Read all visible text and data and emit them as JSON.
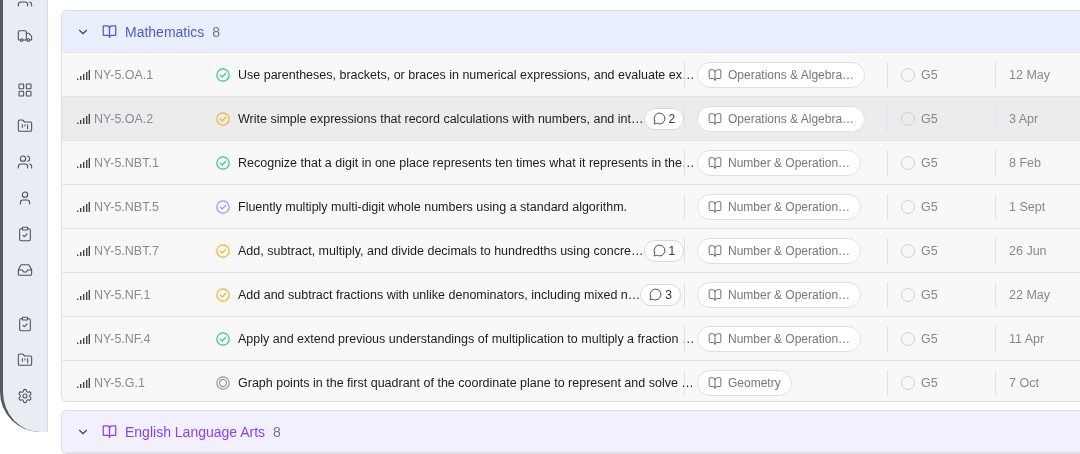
{
  "groups": [
    {
      "title": "Mathematics",
      "count": "8",
      "color": "#4f5bd5",
      "expanded": true,
      "rows": [
        {
          "code": "NY-5.OA.1",
          "kind": "done",
          "title": "Use parentheses, brackets, or braces in numerical expressions, and evaluate ex…",
          "comments": null,
          "tag": "Operations & Algebra…",
          "grade": "G5",
          "date": "12 May",
          "selected": false
        },
        {
          "code": "NY-5.OA.2",
          "kind": "in_progress",
          "title": "Write simple expressions that record calculations with numbers, and int…",
          "comments": "2",
          "tag": "Operations & Algebra…",
          "grade": "G5",
          "date": "3 Apr",
          "selected": true
        },
        {
          "code": "NY-5.NBT.1",
          "kind": "done",
          "title": "Recognize that a digit in one place represents ten times what it represents in the…",
          "comments": null,
          "tag": "Number & Operation…",
          "grade": "G5",
          "date": "8 Feb",
          "selected": false
        },
        {
          "code": "NY-5.NBT.5",
          "kind": "review",
          "title": "Fluently multiply multi-digit whole numbers using a standard algorithm.",
          "comments": null,
          "tag": "Number & Operation…",
          "grade": "G5",
          "date": "1 Sept",
          "selected": false
        },
        {
          "code": "NY-5.NBT.7",
          "kind": "in_progress",
          "title": "Add, subtract, multiply, and divide decimals to hundredths using concre…",
          "comments": "1",
          "tag": "Number & Operation…",
          "grade": "G5",
          "date": "26 Jun",
          "selected": false
        },
        {
          "code": "NY-5.NF.1",
          "kind": "in_progress",
          "title": "Add and subtract fractions with unlike denominators, including mixed n…",
          "comments": "3",
          "tag": "Number & Operation…",
          "grade": "G5",
          "date": "22 May",
          "selected": false
        },
        {
          "code": "NY-5.NF.4",
          "kind": "done",
          "title": "Apply and extend previous understandings of multiplication to multiply a fraction …",
          "comments": null,
          "tag": "Number & Operation…",
          "grade": "G5",
          "date": "11 Apr",
          "selected": false
        },
        {
          "code": "NY-5.G.1",
          "kind": "backlog",
          "title": "Graph points in the first quadrant of the coordinate plane to represent and solve …",
          "comments": null,
          "tag": "Geometry",
          "grade": "G5",
          "date": "7 Oct",
          "selected": false
        }
      ]
    },
    {
      "title": "English Language Arts",
      "count": "8",
      "color": "#8a3ffc",
      "expanded": true
    }
  ]
}
